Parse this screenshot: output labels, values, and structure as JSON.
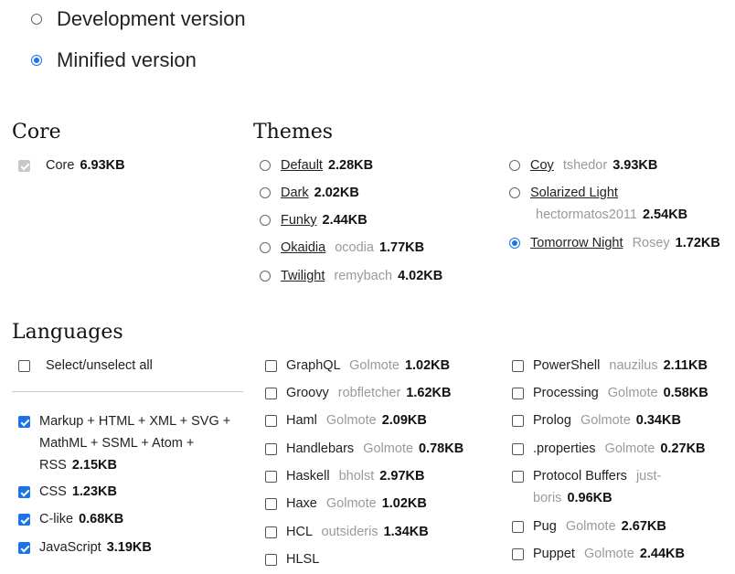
{
  "download": {
    "development_label": "Development version",
    "minified_label": "Minified version",
    "selected": "minified"
  },
  "core": {
    "heading": "Core",
    "item": {
      "label": "Core",
      "size": "6.93KB",
      "checked": true,
      "disabled": true
    }
  },
  "themes": {
    "heading": "Themes",
    "items": [
      {
        "label": "Default",
        "author": "",
        "size": "2.28KB",
        "selected": false
      },
      {
        "label": "Dark",
        "author": "",
        "size": "2.02KB",
        "selected": false
      },
      {
        "label": "Funky",
        "author": "",
        "size": "2.44KB",
        "selected": false
      },
      {
        "label": "Okaidia",
        "author": "ocodia",
        "size": "1.77KB",
        "selected": false
      },
      {
        "label": "Twilight",
        "author": "remybach",
        "size": "4.02KB",
        "selected": false
      },
      {
        "label": "Coy",
        "author": "tshedor",
        "size": "3.93KB",
        "selected": false
      },
      {
        "label": "Solarized Light",
        "author": "hectormatos2011",
        "size": "2.54KB",
        "selected": false
      },
      {
        "label": "Tomorrow Night",
        "author": "Rosey",
        "size": "1.72KB",
        "selected": true
      }
    ]
  },
  "languages": {
    "heading": "Languages",
    "select_all_label": "Select/unselect all",
    "items": [
      {
        "label": "Markup + HTML + XML + SVG + MathML + SSML + Atom + RSS",
        "author": "",
        "size": "2.15KB",
        "checked": true
      },
      {
        "label": "CSS",
        "author": "",
        "size": "1.23KB",
        "checked": true
      },
      {
        "label": "C-like",
        "author": "",
        "size": "0.68KB",
        "checked": true
      },
      {
        "label": "JavaScript",
        "author": "",
        "size": "3.19KB",
        "checked": true
      },
      {
        "label": "GraphQL",
        "author": "Golmote",
        "size": "1.02KB",
        "checked": false
      },
      {
        "label": "Groovy",
        "author": "robfletcher",
        "size": "1.62KB",
        "checked": false
      },
      {
        "label": "Haml",
        "author": "Golmote",
        "size": "2.09KB",
        "checked": false
      },
      {
        "label": "Handlebars",
        "author": "Golmote",
        "size": "0.78KB",
        "checked": false
      },
      {
        "label": "Haskell",
        "author": "bholst",
        "size": "2.97KB",
        "checked": false
      },
      {
        "label": "Haxe",
        "author": "Golmote",
        "size": "1.02KB",
        "checked": false
      },
      {
        "label": "HCL",
        "author": "outsideris",
        "size": "1.34KB",
        "checked": false
      },
      {
        "label": "HLSL",
        "author": "",
        "size": "",
        "checked": false
      },
      {
        "label": "PowerShell",
        "author": "nauzilus",
        "size": "2.11KB",
        "checked": false
      },
      {
        "label": "Processing",
        "author": "Golmote",
        "size": "0.58KB",
        "checked": false
      },
      {
        "label": "Prolog",
        "author": "Golmote",
        "size": "0.34KB",
        "checked": false
      },
      {
        "label": ".properties",
        "author": "Golmote",
        "size": "0.27KB",
        "checked": false
      },
      {
        "label": "Protocol Buffers",
        "author": "just-boris",
        "size": "0.96KB",
        "checked": false
      },
      {
        "label": "Pug",
        "author": "Golmote",
        "size": "2.67KB",
        "checked": false
      },
      {
        "label": "Puppet",
        "author": "Golmote",
        "size": "2.44KB",
        "checked": false
      }
    ]
  },
  "colors": {
    "accent": "#1a73e8",
    "author_text": "#9a9a9a",
    "divider": "#c8c8c8"
  }
}
